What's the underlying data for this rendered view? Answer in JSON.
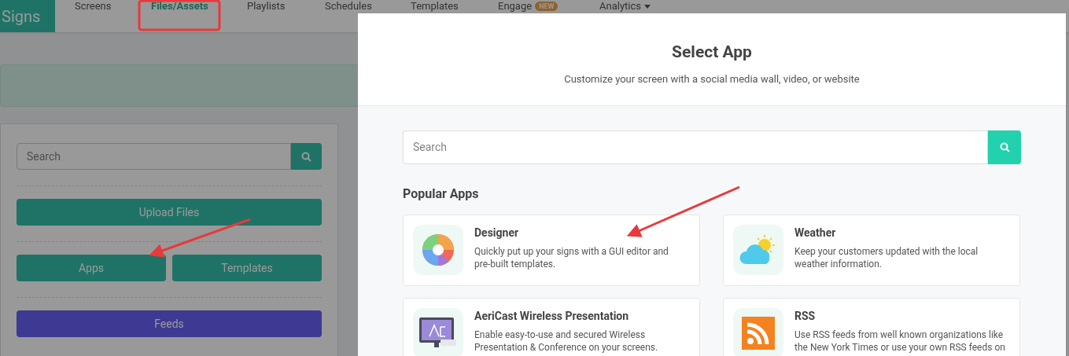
{
  "brand": "Signs",
  "nav": [
    {
      "label": "Screens",
      "selected": false
    },
    {
      "label": "Files/Assets",
      "selected": true
    },
    {
      "label": "Playlists",
      "selected": false
    },
    {
      "label": "Schedules",
      "selected": false
    },
    {
      "label": "Templates",
      "selected": false
    },
    {
      "label": "Engage",
      "selected": false,
      "badge": "NEW"
    },
    {
      "label": "Analytics",
      "selected": false,
      "dropdown": true
    }
  ],
  "sidebar": {
    "search": {
      "placeholder": "Search"
    },
    "button_rows": [
      [
        {
          "label": "Upload Files",
          "kind": "primary"
        }
      ],
      [
        {
          "label": "Apps",
          "kind": "primary"
        },
        {
          "label": "Templates",
          "kind": "primary"
        }
      ],
      [
        {
          "label": "Feeds",
          "kind": "feeds"
        }
      ]
    ]
  },
  "modal": {
    "title": "Select App",
    "subtitle": "Customize your screen with a social media wall, video, or website",
    "search": {
      "placeholder": "Search"
    },
    "section": "Popular Apps",
    "apps": [
      {
        "name": "Designer",
        "description": "Quickly put up your signs with a GUI editor and pre-built templates.",
        "kind": "designer"
      },
      {
        "name": "Weather",
        "description": "Keep your customers updated with the local weather information.",
        "kind": "weather"
      },
      {
        "name": "AeriCast Wireless Presentation",
        "description": "Enable easy-to-use and secured Wireless Presentation & Conference on your screens.",
        "kind": "aericast"
      },
      {
        "name": "RSS",
        "description": "Use RSS feeds from well known organizations like the New York Times or use your own RSS feeds on",
        "kind": "rss"
      }
    ]
  }
}
